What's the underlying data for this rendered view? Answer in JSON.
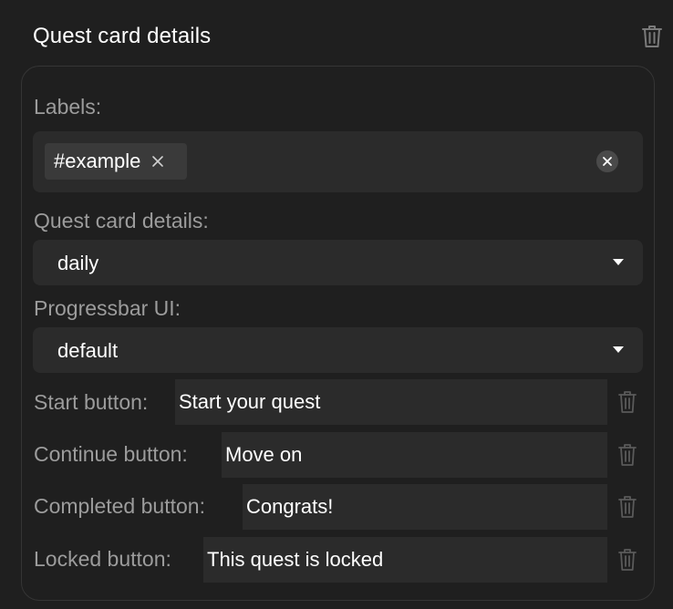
{
  "header": {
    "title": "Quest card details"
  },
  "labels_field": {
    "label": "Labels:",
    "chips": [
      {
        "text": "#example"
      }
    ]
  },
  "quest_details_field": {
    "label": "Quest card details:",
    "selected": "daily"
  },
  "progressbar_field": {
    "label": "Progressbar UI:",
    "selected": "default"
  },
  "buttons": {
    "start": {
      "label": "Start button:",
      "value": "Start your quest"
    },
    "continue": {
      "label": "Continue button:",
      "value": "Move on"
    },
    "completed": {
      "label": "Completed button:",
      "value": "Congrats!"
    },
    "locked": {
      "label": "Locked button:",
      "value": "This quest is locked"
    }
  },
  "colors": {
    "background": "#1f1f1f",
    "field_background": "#2b2b2b",
    "chip_background": "#3a3a3a",
    "muted_text": "#9c9c9c",
    "text": "#ffffff",
    "border": "#353535"
  },
  "icons": {
    "delete": "trash-icon",
    "remove_chip": "close-icon",
    "clear_all": "close-circle-icon",
    "dropdown": "caret-down-icon"
  }
}
